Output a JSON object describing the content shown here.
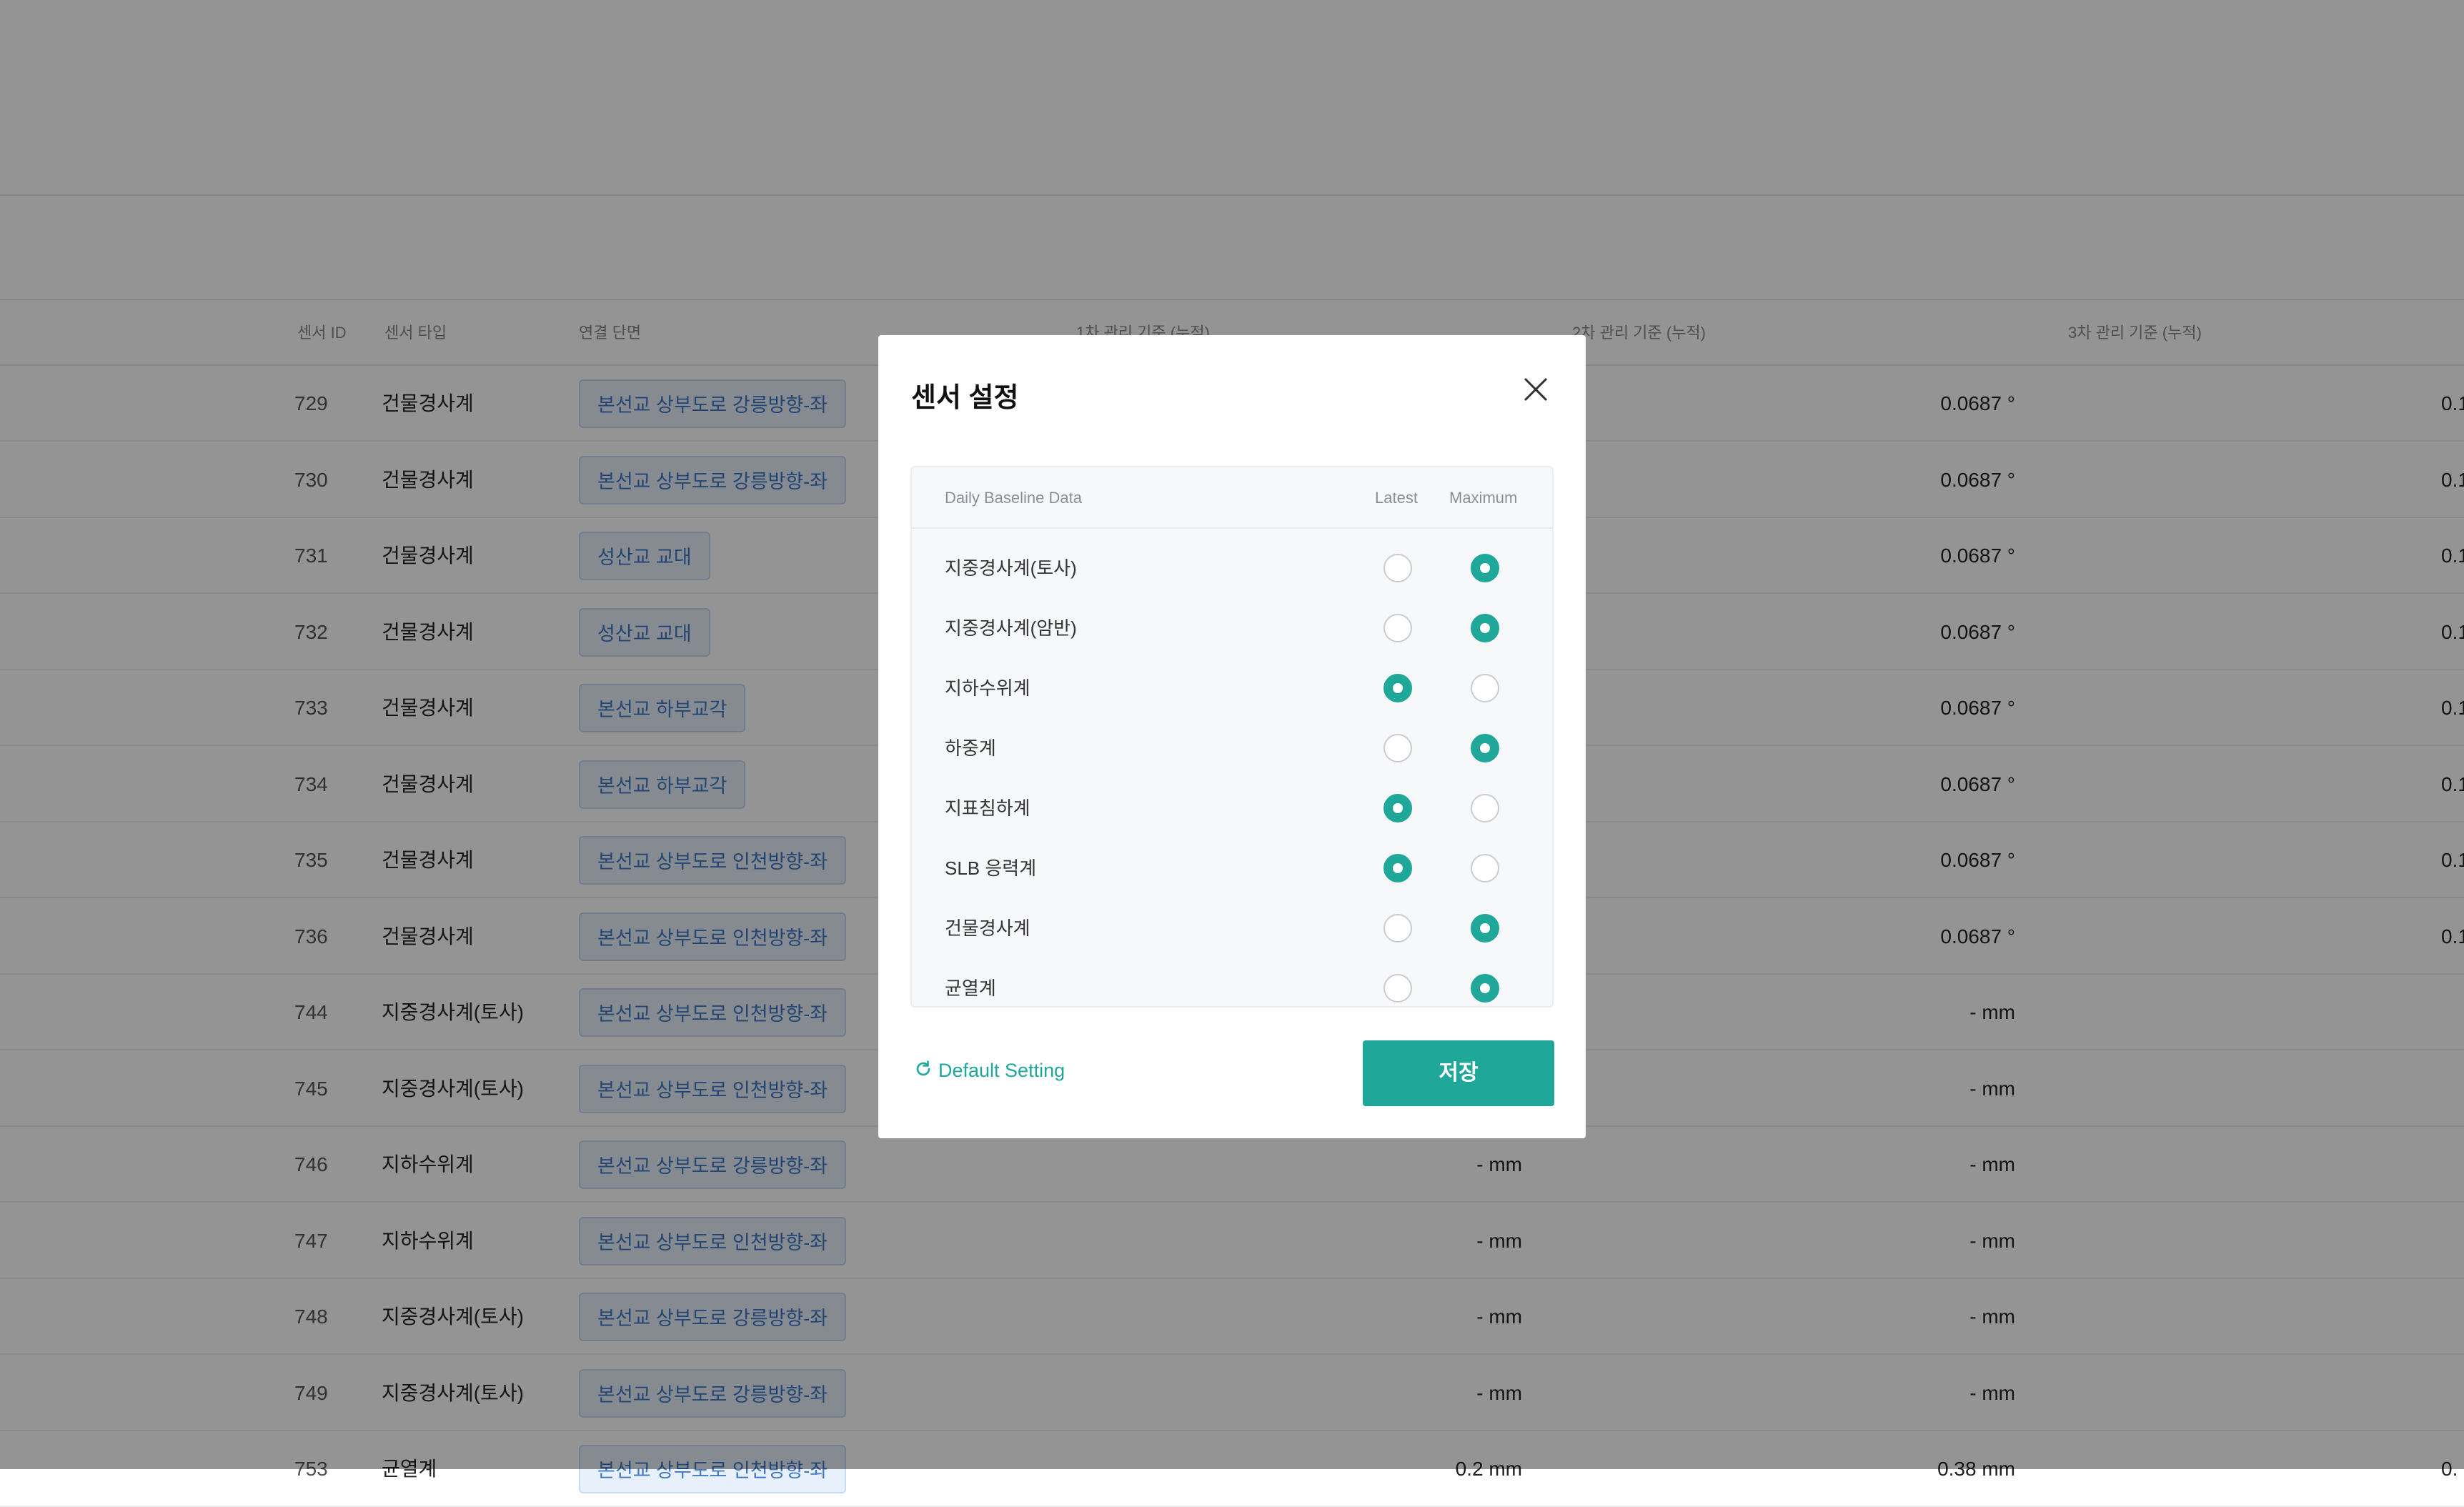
{
  "table": {
    "headers": {
      "sensor_id": "센서 ID",
      "sensor_type": "센서 타입",
      "connected_section": "연결 단면",
      "level1": "1차 관리 기준 (누적)",
      "level2": "2차 관리 기준 (누적)",
      "level3": "3차 관리 기준 (누적)"
    },
    "rows": [
      {
        "id": "729",
        "type": "건물경사계",
        "section": "본선교 상부도로 강릉방향-좌",
        "v1": "",
        "v2": "0.0687 °",
        "v3": "0.1"
      },
      {
        "id": "730",
        "type": "건물경사계",
        "section": "본선교 상부도로 강릉방향-좌",
        "v1": "",
        "v2": "0.0687 °",
        "v3": "0.1"
      },
      {
        "id": "731",
        "type": "건물경사계",
        "section": "성산교 교대",
        "v1": "",
        "v2": "0.0687 °",
        "v3": "0.1"
      },
      {
        "id": "732",
        "type": "건물경사계",
        "section": "성산교 교대",
        "v1": "",
        "v2": "0.0687 °",
        "v3": "0.1"
      },
      {
        "id": "733",
        "type": "건물경사계",
        "section": "본선교 하부교각",
        "v1": "",
        "v2": "0.0687 °",
        "v3": "0.1"
      },
      {
        "id": "734",
        "type": "건물경사계",
        "section": "본선교 하부교각",
        "v1": "",
        "v2": "0.0687 °",
        "v3": "0.1"
      },
      {
        "id": "735",
        "type": "건물경사계",
        "section": "본선교 상부도로 인천방향-좌",
        "v1": "",
        "v2": "0.0687 °",
        "v3": "0.1"
      },
      {
        "id": "736",
        "type": "건물경사계",
        "section": "본선교 상부도로 인천방향-좌",
        "v1": "",
        "v2": "0.0687 °",
        "v3": "0.1"
      },
      {
        "id": "744",
        "type": "지중경사계(토사)",
        "section": "본선교 상부도로 인천방향-좌",
        "v1": "",
        "v2": "- mm",
        "v3": ""
      },
      {
        "id": "745",
        "type": "지중경사계(토사)",
        "section": "본선교 상부도로 인천방향-좌",
        "v1": "",
        "v2": "- mm",
        "v3": ""
      },
      {
        "id": "746",
        "type": "지하수위계",
        "section": "본선교 상부도로 강릉방향-좌",
        "v1": "- mm",
        "v2": "- mm",
        "v3": ""
      },
      {
        "id": "747",
        "type": "지하수위계",
        "section": "본선교 상부도로 인천방향-좌",
        "v1": "- mm",
        "v2": "- mm",
        "v3": ""
      },
      {
        "id": "748",
        "type": "지중경사계(토사)",
        "section": "본선교 상부도로 강릉방향-좌",
        "v1": "- mm",
        "v2": "- mm",
        "v3": ""
      },
      {
        "id": "749",
        "type": "지중경사계(토사)",
        "section": "본선교 상부도로 강릉방향-좌",
        "v1": "- mm",
        "v2": "- mm",
        "v3": ""
      },
      {
        "id": "753",
        "type": "균열계",
        "section": "본선교 상부도로 인천방향-좌",
        "v1": "0.2 mm",
        "v2": "0.38 mm",
        "v3": "0."
      }
    ]
  },
  "modal": {
    "title": "센서 설정",
    "table_header": {
      "label": "Daily Baseline Data",
      "latest": "Latest",
      "maximum": "Maximum"
    },
    "options": [
      {
        "label": "지중경사계(토사)",
        "selected": "maximum"
      },
      {
        "label": "지중경사계(암반)",
        "selected": "maximum"
      },
      {
        "label": "지하수위계",
        "selected": "latest"
      },
      {
        "label": "하중계",
        "selected": "maximum"
      },
      {
        "label": "지표침하계",
        "selected": "latest"
      },
      {
        "label": "SLB 응력계",
        "selected": "latest"
      },
      {
        "label": "건물경사계",
        "selected": "maximum"
      },
      {
        "label": "균열계",
        "selected": "maximum"
      }
    ],
    "default_setting_label": "Default Setting",
    "save_label": "저장"
  },
  "colors": {
    "accent": "#1fa89a",
    "chip_text": "#3f78c5",
    "chip_bg": "#e7f0fb",
    "overlay": "rgba(0,0,0,0.42)"
  },
  "icons": {
    "close": "close-icon",
    "refresh": "refresh-icon"
  }
}
